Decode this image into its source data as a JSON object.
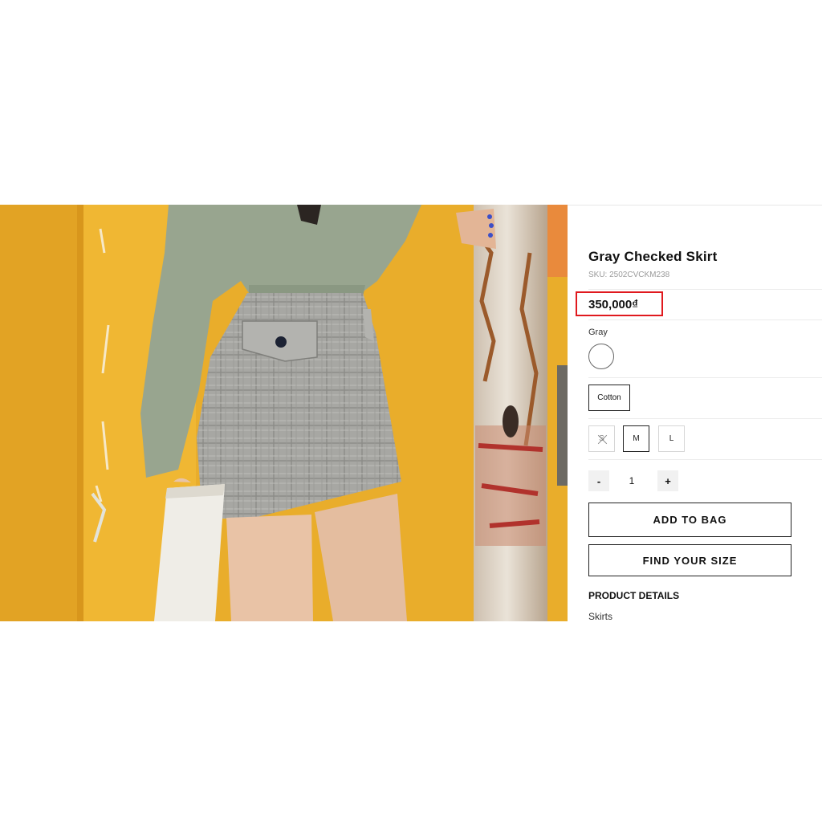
{
  "product": {
    "title": "Gray Checked Skirt",
    "sku_prefix": "SKU:",
    "sku": "2502CVCKM238",
    "price": "350,000₫",
    "color_name": "Gray",
    "material": "Cotton",
    "sizes": [
      {
        "label": "S",
        "available": false,
        "selected": false
      },
      {
        "label": "M",
        "available": true,
        "selected": true
      },
      {
        "label": "L",
        "available": true,
        "selected": false
      }
    ],
    "quantity": {
      "minus": "-",
      "value": "1",
      "plus": "+"
    },
    "add_to_bag": "ADD TO BAG",
    "find_size": "FIND YOUR SIZE",
    "details_heading": "PRODUCT DETAILS",
    "category": "Skirts"
  },
  "colors": {
    "highlight": "#e0191e",
    "wall": "#e8ac2a",
    "skirt": "#a9a9a5",
    "shirt": "#98a58f"
  },
  "image": {
    "subject": "model wearing gray checked mini skirt against yellow wall"
  }
}
